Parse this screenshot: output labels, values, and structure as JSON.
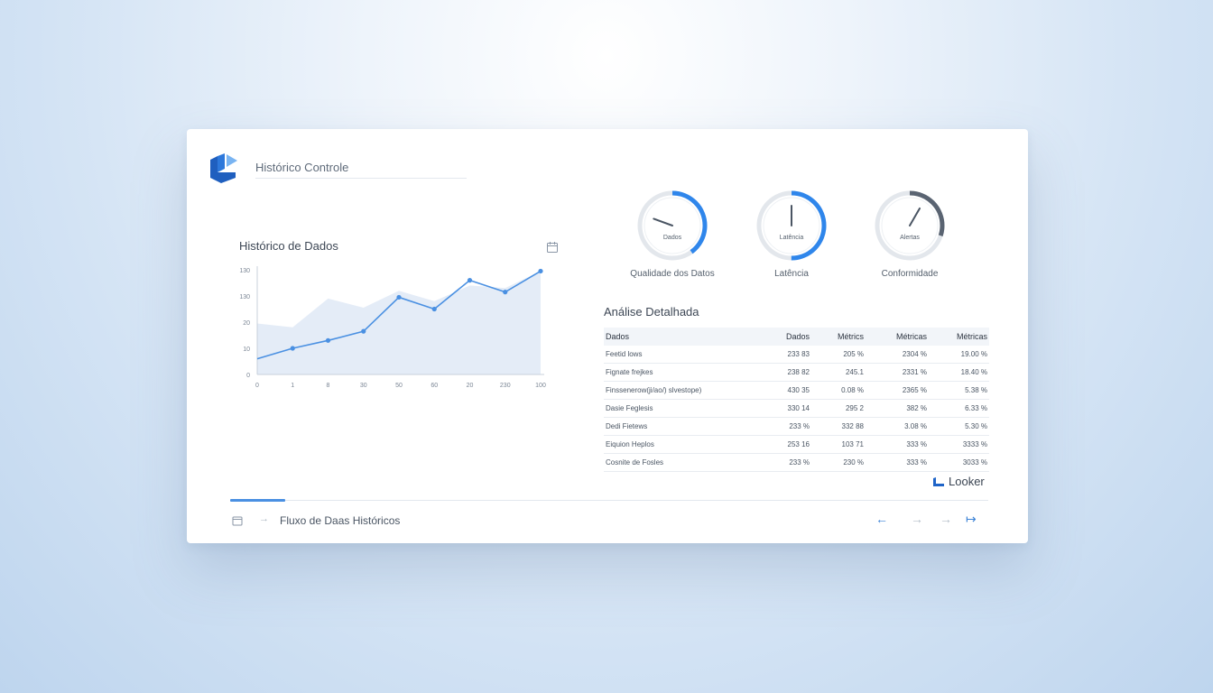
{
  "app": {
    "title": "Histórico Controle",
    "brand": "Looker"
  },
  "chart_section": {
    "title": "Histórico de Dados",
    "icon": "calendar-icon"
  },
  "chart_data": {
    "type": "line",
    "title": "Histórico de Dados",
    "x_tick_labels": [
      "0",
      "1",
      "8",
      "30",
      "50",
      "60",
      "20",
      "230",
      "100"
    ],
    "y_tick_labels": [
      "0",
      "10",
      "20",
      "130",
      "130"
    ],
    "series": [
      {
        "values": [
          6,
          10,
          13,
          16.5,
          29.5,
          25,
          36,
          31.5,
          39.5
        ]
      }
    ],
    "area_band": [
      19.5,
      18,
      29,
      25.5,
      32,
      28,
      34,
      33,
      39.5
    ],
    "ylim": [
      0,
      40
    ],
    "grid": false,
    "colors": {
      "line": "#4a90e2",
      "area": "#dfe9f6"
    }
  },
  "gauges": [
    {
      "inner_label": "Dados",
      "label": "Qualidade dos Datos",
      "fraction": 0.4,
      "color": "#2f86eb",
      "needle_deg": 290
    },
    {
      "inner_label": "Latência",
      "label": "Latência",
      "fraction": 0.5,
      "color": "#2f86eb",
      "needle_deg": 0
    },
    {
      "inner_label": "Alertas",
      "label": "Conformidade",
      "fraction": 0.3,
      "color": "#5a6472",
      "needle_deg": 30
    }
  ],
  "table": {
    "title": "Análise Detalhada",
    "headers": [
      "Dados",
      "Dados",
      "Métrics",
      "Métricas",
      "Métricas"
    ],
    "rows": [
      [
        "Feetid lows",
        "233 83",
        "205 %",
        "2304 %",
        "19.00 %"
      ],
      [
        "Fignate frejkes",
        "238 82",
        "245.1",
        "2331 %",
        "18.40 %"
      ],
      [
        "Finssenerow(ji/ao/) slvestope)",
        "430 35",
        "0.08 %",
        "2365 %",
        "5.38 %"
      ],
      [
        "Dasie Feglesis",
        "330 14",
        "295 2",
        "382 %",
        "6.33 %"
      ],
      [
        "Dedi Fietews",
        "233 %",
        "332 88",
        "3.08 %",
        "5.30 %"
      ],
      [
        "Eiquion Heplos",
        "253 16",
        "103 71",
        "333 %",
        "3333 %"
      ],
      [
        "Cosnite de Fosles",
        "233 %",
        "230 %",
        "333 %",
        "3033 %"
      ]
    ]
  },
  "footer": {
    "label": "Fluxo de Daas Históricos",
    "progress_fraction": 0.073,
    "nav": [
      {
        "name": "back",
        "glyph": "←"
      },
      {
        "name": "forward-1",
        "glyph": "→"
      },
      {
        "name": "forward-2",
        "glyph": "→"
      },
      {
        "name": "forward-3",
        "glyph": "↦"
      }
    ]
  }
}
